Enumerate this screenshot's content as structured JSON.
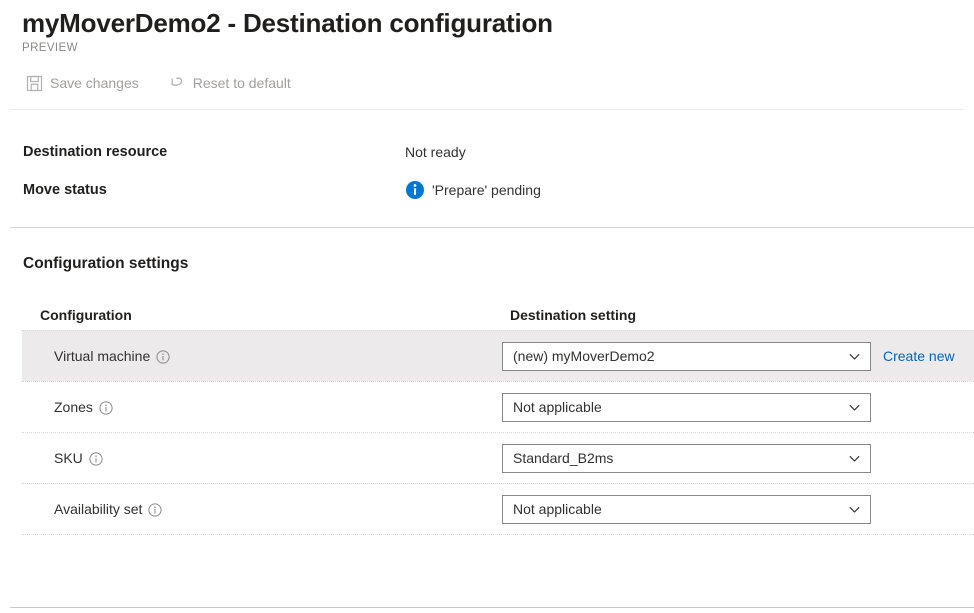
{
  "header": {
    "title": "myMoverDemo2 - Destination configuration",
    "preview_label": "PREVIEW"
  },
  "command_bar": {
    "buttons": [
      {
        "label": "Save changes",
        "icon": "save-icon",
        "enabled": false
      },
      {
        "label": "Reset to default",
        "icon": "undo-icon",
        "enabled": false
      }
    ]
  },
  "status": {
    "rows": [
      {
        "label": "Destination resource",
        "value": "Not ready",
        "icon": null
      },
      {
        "label": "Move status",
        "value": "'Prepare' pending",
        "icon": "info-filled-icon"
      }
    ]
  },
  "settings": {
    "section_title": "Configuration settings",
    "columns": {
      "configuration": "Configuration",
      "destination_setting": "Destination setting"
    },
    "rows": [
      {
        "label": "Virtual machine",
        "info_icon": "info-outline-icon",
        "value": "(new) myMoverDemo2",
        "highlighted": true,
        "action_link": "Create new"
      },
      {
        "label": "Zones",
        "info_icon": "info-outline-icon",
        "value": "Not applicable",
        "highlighted": false,
        "action_link": null
      },
      {
        "label": "SKU",
        "info_icon": "info-outline-icon",
        "value": "Standard_B2ms",
        "highlighted": false,
        "action_link": null
      },
      {
        "label": "Availability set",
        "info_icon": "info-outline-icon",
        "value": "Not applicable",
        "highlighted": false,
        "action_link": null
      }
    ]
  },
  "colors": {
    "accent_blue": "#0078d4",
    "link_blue": "#0066bb",
    "row_highlight": "#eceaea",
    "disabled_text": "#a19f9d"
  }
}
